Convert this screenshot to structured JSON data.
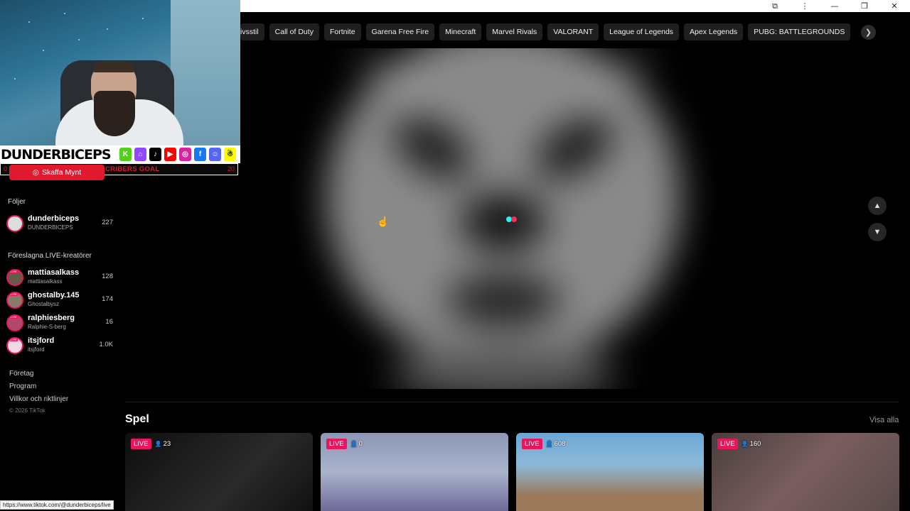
{
  "categories": [
    "ivsstil",
    "Call of Duty",
    "Fortnite",
    "Garena Free Fire",
    "Minecraft",
    "Marvel Rivals",
    "VALORANT",
    "League of Legends",
    "Apex Legends",
    "PUBG: BATTLEGROUNDS"
  ],
  "overlay": {
    "brand": "DUNDERBICEPS",
    "goal_text": "CRIBERS GOAL",
    "goal_left": "0",
    "goal_right": "20",
    "coins_button": "Skaffa Mynt"
  },
  "sidebar": {
    "following_heading": "Följer",
    "following": [
      {
        "name": "dunderbiceps",
        "sub": "DUNDERBICEPS",
        "count": "227"
      }
    ],
    "suggested_heading": "Föreslagna LIVE-kreatörer",
    "suggested": [
      {
        "name": "mattiasalkass",
        "sub": "mattiasalkass",
        "count": "128"
      },
      {
        "name": "ghostalby.145",
        "sub": "Ghostalbysz",
        "count": "174"
      },
      {
        "name": "ralphiesberg",
        "sub": "Ralphie-S-berg",
        "count": "16"
      },
      {
        "name": "itsjford",
        "sub": "itsjford",
        "count": "1.0K"
      }
    ],
    "links": [
      "Företag",
      "Program",
      "Villkor och riktlinjer"
    ],
    "copyright": "© 2026 TikTok"
  },
  "games": {
    "title": "Spel",
    "see_all": "Visa alla",
    "cards": [
      {
        "live": "LIVE",
        "viewers": "23"
      },
      {
        "live": "LIVE",
        "viewers": "0"
      },
      {
        "live": "LIVE",
        "viewers": "608"
      },
      {
        "live": "LIVE",
        "viewers": "160"
      }
    ]
  },
  "statusbar": "https://www.tiktok.com/@dunderbiceps/live",
  "colors": {
    "accent": "#e6175c",
    "goal_red": "#e0192e",
    "loader_cyan": "#25f4ee",
    "loader_pink": "#fe2c55"
  }
}
